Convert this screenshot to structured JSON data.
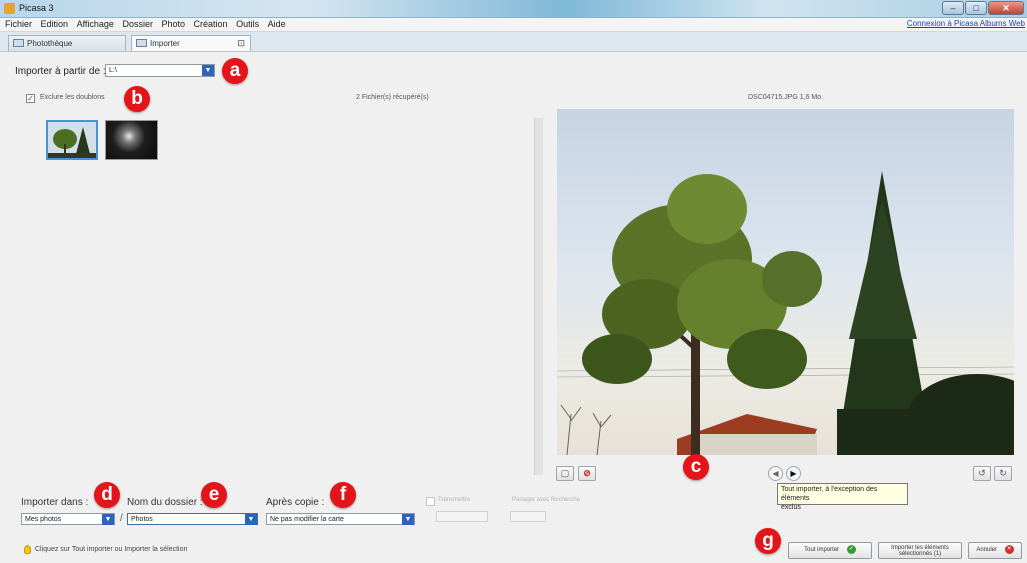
{
  "window": {
    "title": "Picasa 3",
    "minimize": "–",
    "maximize": "□",
    "close": "✕"
  },
  "menu": {
    "items": [
      "Fichier",
      "Edition",
      "Affichage",
      "Dossier",
      "Photo",
      "Création",
      "Outils",
      "Aide"
    ],
    "sign_in": "Connexion à Picasa Albums Web"
  },
  "tabs": [
    {
      "label": "Photothèque"
    },
    {
      "label": "Importer",
      "close": "⊡"
    }
  ],
  "import": {
    "source_label": "Importer à partir de :",
    "source_value": "L:\\",
    "exclude_label": "Exclure les doublons",
    "exclude_checked": "✓",
    "files_found": "2 Fichier(s) récupéré(s)",
    "file_info": "DSC04715.JPG   1,6 Mo"
  },
  "badges": {
    "a": "a",
    "b": "b",
    "c": "c",
    "d": "d",
    "e": "e",
    "f": "f",
    "g": "g"
  },
  "preview_nav": {
    "prev": "◀",
    "next": "▶",
    "tooltip_line1": "Tout importer, à l'exception des éléments",
    "tooltip_line2": "exclus"
  },
  "options": {
    "destination_label": "Importer dans :",
    "destination_value": "Mes photos",
    "folder_label": "Nom du dossier :",
    "folder_value": "Photos",
    "after_copy_label": "Après copie :",
    "after_copy_value": "Ne pas modifier la carte",
    "slash": "/",
    "disabled_opt1": "Transmettre",
    "disabled_opt2": "Partager avec   Recherche"
  },
  "status": {
    "hint": "Cliquez sur Tout importer ou Importer la sélection"
  },
  "buttons": {
    "import_all": "Tout importer",
    "import_selected_line1": "Importer les éléments",
    "import_selected_line2": "sélectionnés (1)",
    "cancel": "Annuler",
    "ok_glyph": "✓",
    "cancel_glyph": "✕"
  },
  "icons": {
    "dropdown_arrow": "▼",
    "rotate_left": "↺",
    "rotate_right": "↻",
    "frame": "▢",
    "exclude": "⊘"
  }
}
